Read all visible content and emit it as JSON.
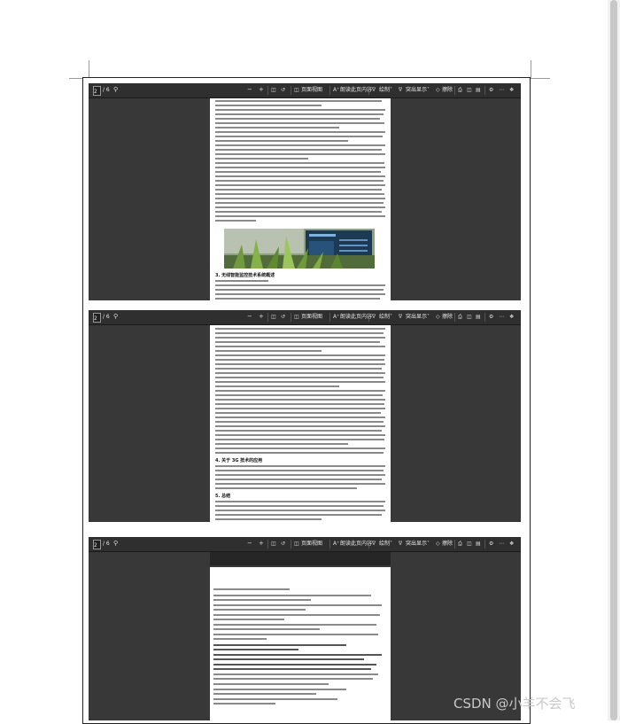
{
  "watermark": "CSDN @小羊不会飞",
  "viewer": {
    "page_current": "2",
    "page_total": "/ 6",
    "search_icon": "magnifier-icon",
    "zoom_minus": "−",
    "zoom_plus": "+",
    "page_view_label": "页面视图",
    "read_aloud_label": "朗读此页内容",
    "draw_label": "绘制",
    "highlight_label": "突出显示",
    "erase_label": "擦除"
  },
  "page_sections": {
    "section_3": "3. 无线智能监控技术系统概述",
    "section_4": "4. 关于 3G 技术的应用",
    "section_5": "5. 总结"
  },
  "references": [
    "参考文献",
    "[1] 智能视频监控技术的研究[J]. 2006, 10: 132-137.",
    "[2] 视频监控在城市安防中的应用研究[J].",
    "[3] 基于无线网络的智能监控系统设计[J].",
    "[4] 移动视频监控技术发展综述[J].",
    "[5] 3G 网络视频传输技术研究[J].",
    "[6] Non-negative Matrix Factorization and Classifiers: Experimental Study",
    "[7] Autonomous Agent for On-screen Networked Incident Management, Shadow Detection",
    "[8] The possibility of passive object tracking with the use of an Experimental camera",
    "[9] 基于 Android 的视频监控客户端设计[J].",
    "[10] 嵌入式视频监控系统的实现[J].",
    "[11] 视频编码标准及其应用[J]. 2011, 12: 1-7."
  ]
}
